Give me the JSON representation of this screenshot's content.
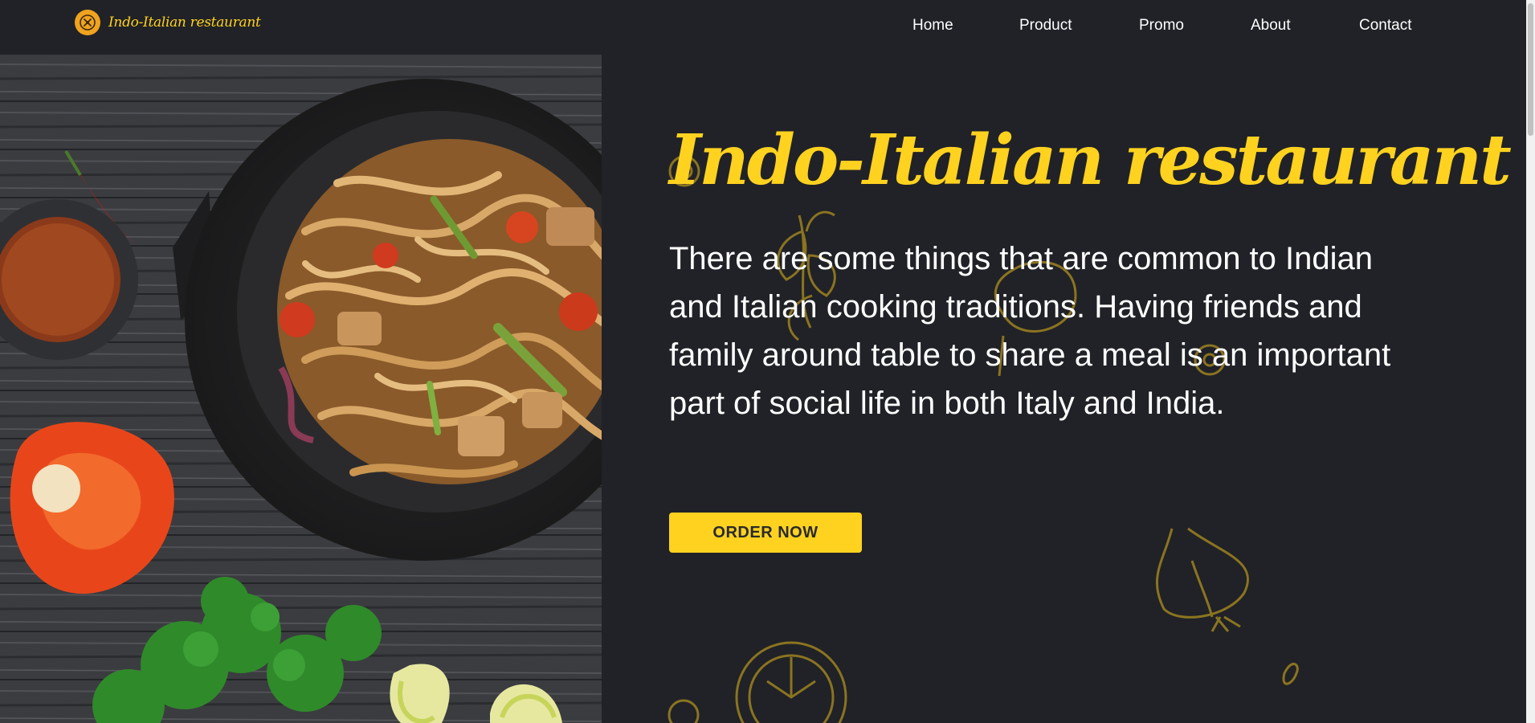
{
  "brand": {
    "name": "Indo-Italian restaurant",
    "logo_icon": "chef-logo-icon",
    "accent_color": "#ffd21f"
  },
  "nav": {
    "items": [
      {
        "label": "Home"
      },
      {
        "label": "Product"
      },
      {
        "label": "Promo"
      },
      {
        "label": "About"
      },
      {
        "label": "Contact"
      }
    ]
  },
  "hero": {
    "title": "Indo-Italian restaurant",
    "description": "There are some things that are common to Indian and Italian cooking traditions. Having friends and family around table to share a meal is an important part of social life in both Italy and India.",
    "cta_label": "ORDER NOW",
    "image_icon": "noodle-wok-image"
  },
  "colors": {
    "background": "#212227",
    "accent": "#ffd21f",
    "text": "#ffffff"
  }
}
